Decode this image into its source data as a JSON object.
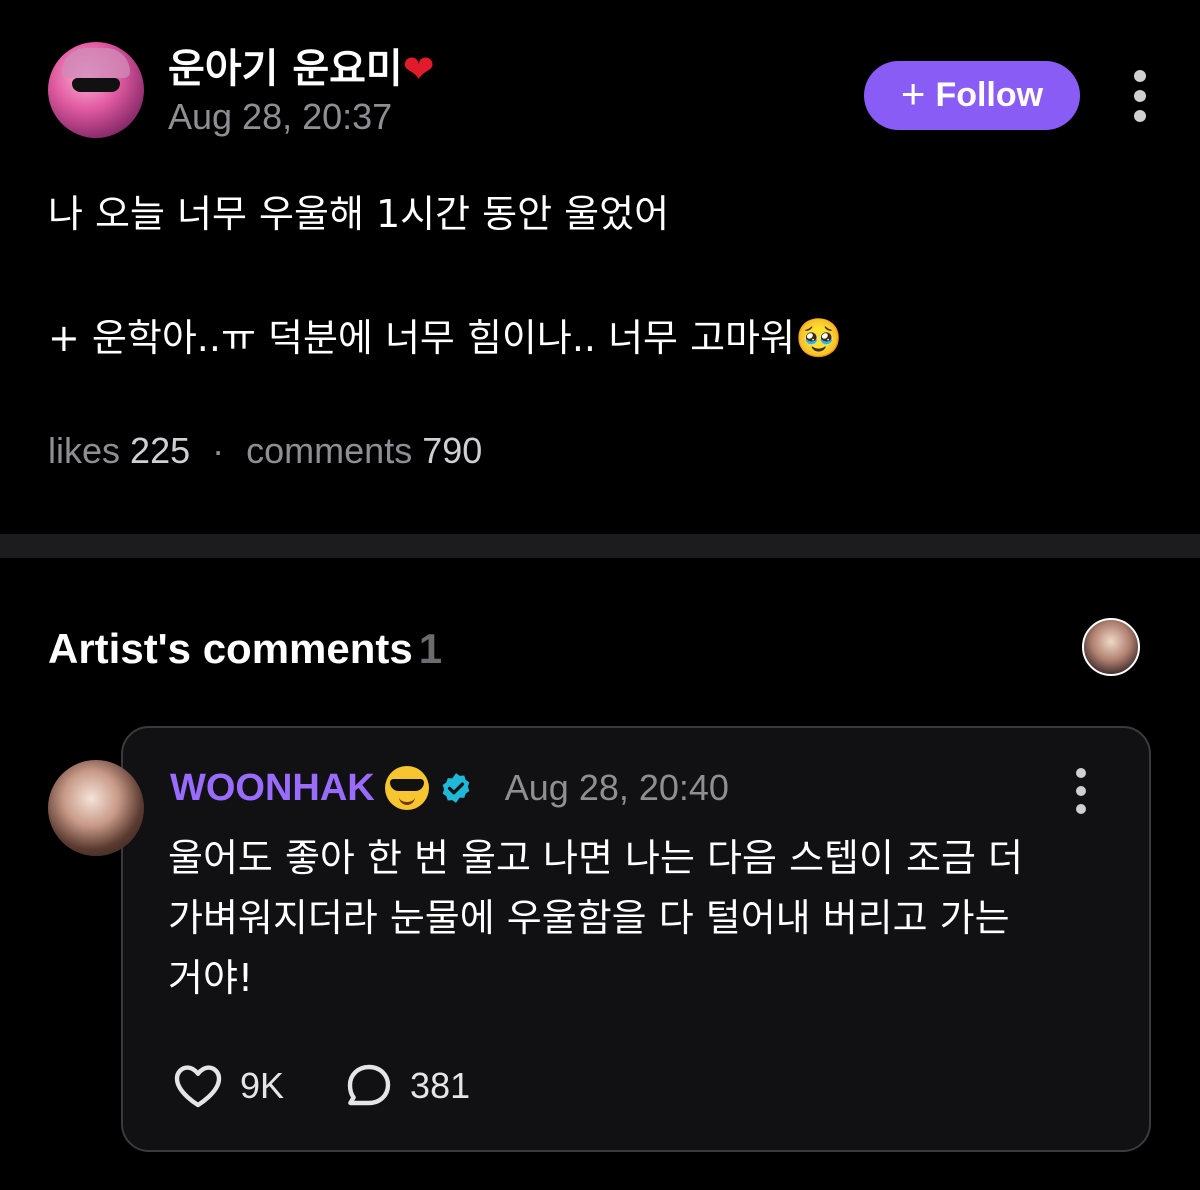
{
  "post": {
    "author_name": "운아기 운요미",
    "author_emoji": "❤",
    "time": "Aug 28, 20:37",
    "follow_label": "Follow",
    "body_line1": "나 오늘 너무 우울해 1시간 동안 울었어",
    "body_line2": "+ 운학아..ㅠ 덕분에 너무 힘이나.. 너무 고마워🥹",
    "likes_label": "likes",
    "likes_count": "225",
    "comments_label": "comments",
    "comments_count": "790"
  },
  "artist_comments": {
    "title": "Artist's comments",
    "count": "1",
    "comment": {
      "author": "WOONHAK",
      "time": "Aug 28, 20:40",
      "text_line1": "울어도 좋아 한 번 울고 나면 나는 다음 스텝이 조금 더",
      "text_line2": "가벼워지더라 눈물에 우울함을 다 털어내 버리고 가는",
      "text_line3": "거야!",
      "likes": "9K",
      "replies": "381"
    }
  },
  "colors": {
    "background": "#000000",
    "accent_purple": "#8a5cf6",
    "artist_name": "#9a6bff",
    "verified": "#1fb8d6",
    "muted_text": "#8e8e93"
  },
  "icons": [
    "more-vertical-icon",
    "plus-icon",
    "verified-badge-icon",
    "heart-outline-icon",
    "comment-bubble-icon"
  ]
}
